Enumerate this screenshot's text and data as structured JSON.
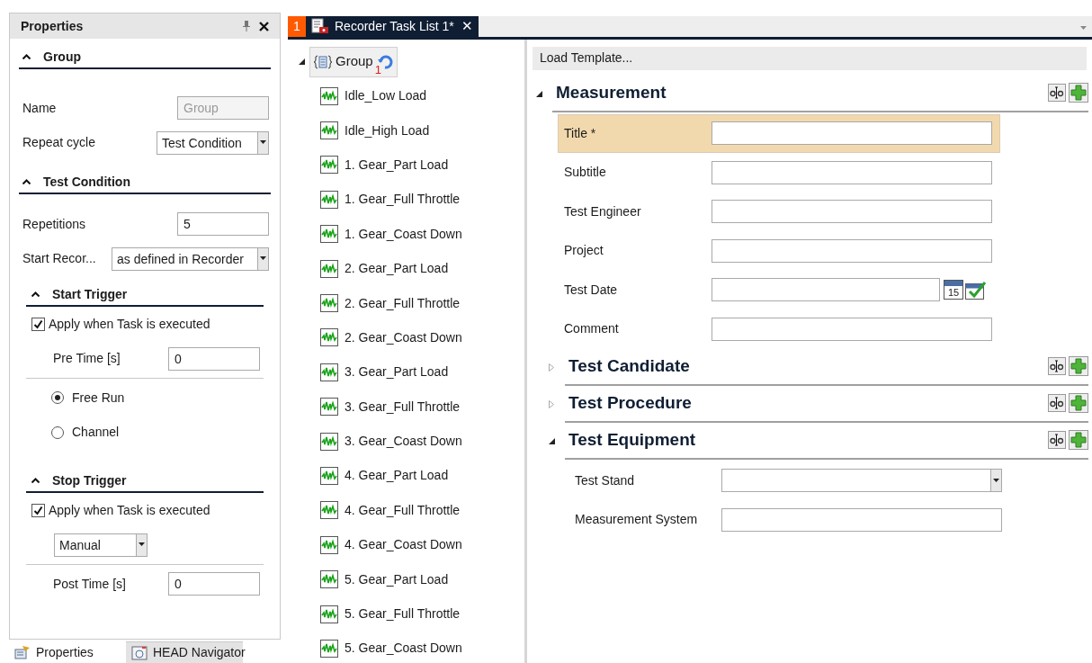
{
  "properties_panel": {
    "title": "Properties",
    "sections": [
      {
        "title": "Group",
        "items": [
          {
            "kind": "field",
            "label": "Name",
            "value": "Group",
            "disabled": true
          },
          {
            "kind": "dropdown",
            "label": "Repeat cycle",
            "value": "Test Condition"
          }
        ]
      },
      {
        "title": "Test Condition",
        "items": [
          {
            "kind": "field",
            "label": "Repetitions",
            "value": "5",
            "disabled": false
          },
          {
            "kind": "dropdown",
            "label": "Start Recor...",
            "value": "as defined in Recorder"
          }
        ],
        "subsections": [
          {
            "title": "Start Trigger",
            "items": [
              {
                "kind": "checkbox",
                "label": "Apply when Task is executed",
                "checked": true
              },
              {
                "kind": "field",
                "label": "Pre Time [s]",
                "value": "0",
                "disabled": false
              },
              {
                "kind": "radio",
                "label": "Free Run",
                "selected": true,
                "separated": true
              },
              {
                "kind": "radio",
                "label": "Channel",
                "selected": false
              }
            ]
          },
          {
            "title": "Stop Trigger",
            "items": [
              {
                "kind": "checkbox",
                "label": "Apply when Task is executed",
                "checked": true
              },
              {
                "kind": "dropdown",
                "value": "Manual"
              },
              {
                "kind": "field",
                "label": "Post Time [s]",
                "value": "0",
                "disabled": false,
                "separated": true
              }
            ]
          }
        ]
      }
    ]
  },
  "bottom_tabs": [
    {
      "label": "Properties",
      "selected": true
    },
    {
      "label": "HEAD Navigator",
      "selected": false
    }
  ],
  "document_tab": {
    "number": "1",
    "title": "Recorder Task List 1*",
    "close": "✕"
  },
  "tree": {
    "label": "Group",
    "expanded": true,
    "badge": "1",
    "children": [
      {
        "label": "Idle_Low Load"
      },
      {
        "label": "Idle_High Load"
      },
      {
        "label": "1. Gear_Part Load"
      },
      {
        "label": "1. Gear_Full Throttle"
      },
      {
        "label": "1. Gear_Coast Down"
      },
      {
        "label": "2. Gear_Part Load"
      },
      {
        "label": "2. Gear_Full Throttle"
      },
      {
        "label": "2. Gear_Coast Down"
      },
      {
        "label": "3. Gear_Part Load"
      },
      {
        "label": "3. Gear_Full Throttle"
      },
      {
        "label": "3. Gear_Coast Down"
      },
      {
        "label": "4. Gear_Part Load"
      },
      {
        "label": "4. Gear_Full Throttle"
      },
      {
        "label": "4. Gear_Coast Down"
      },
      {
        "label": "5. Gear_Part Load"
      },
      {
        "label": "5. Gear_Full Throttle"
      },
      {
        "label": "5. Gear_Coast Down"
      }
    ]
  },
  "form": {
    "load_template": "Load Template...",
    "sections": [
      {
        "title": "Measurement",
        "expanded": true,
        "fields": [
          {
            "kind": "text",
            "label": "Title *",
            "focused": true
          },
          {
            "kind": "text",
            "label": "Subtitle",
            "focused": false
          },
          {
            "kind": "text",
            "label": "Test Engineer",
            "focused": false
          },
          {
            "kind": "text",
            "label": "Project",
            "focused": false
          },
          {
            "kind": "date",
            "label": "Test Date",
            "focused": false,
            "calendar": "15"
          },
          {
            "kind": "text",
            "label": "Comment",
            "focused": false
          }
        ]
      },
      {
        "title": "Test Candidate",
        "expanded": false
      },
      {
        "title": "Test Procedure",
        "expanded": false
      },
      {
        "title": "Test Equipment",
        "expanded": true,
        "fields": [
          {
            "kind": "dropdown",
            "label": "Test Stand",
            "focused": false
          },
          {
            "kind": "text",
            "label": "Measurement System",
            "focused": false
          }
        ]
      }
    ]
  }
}
